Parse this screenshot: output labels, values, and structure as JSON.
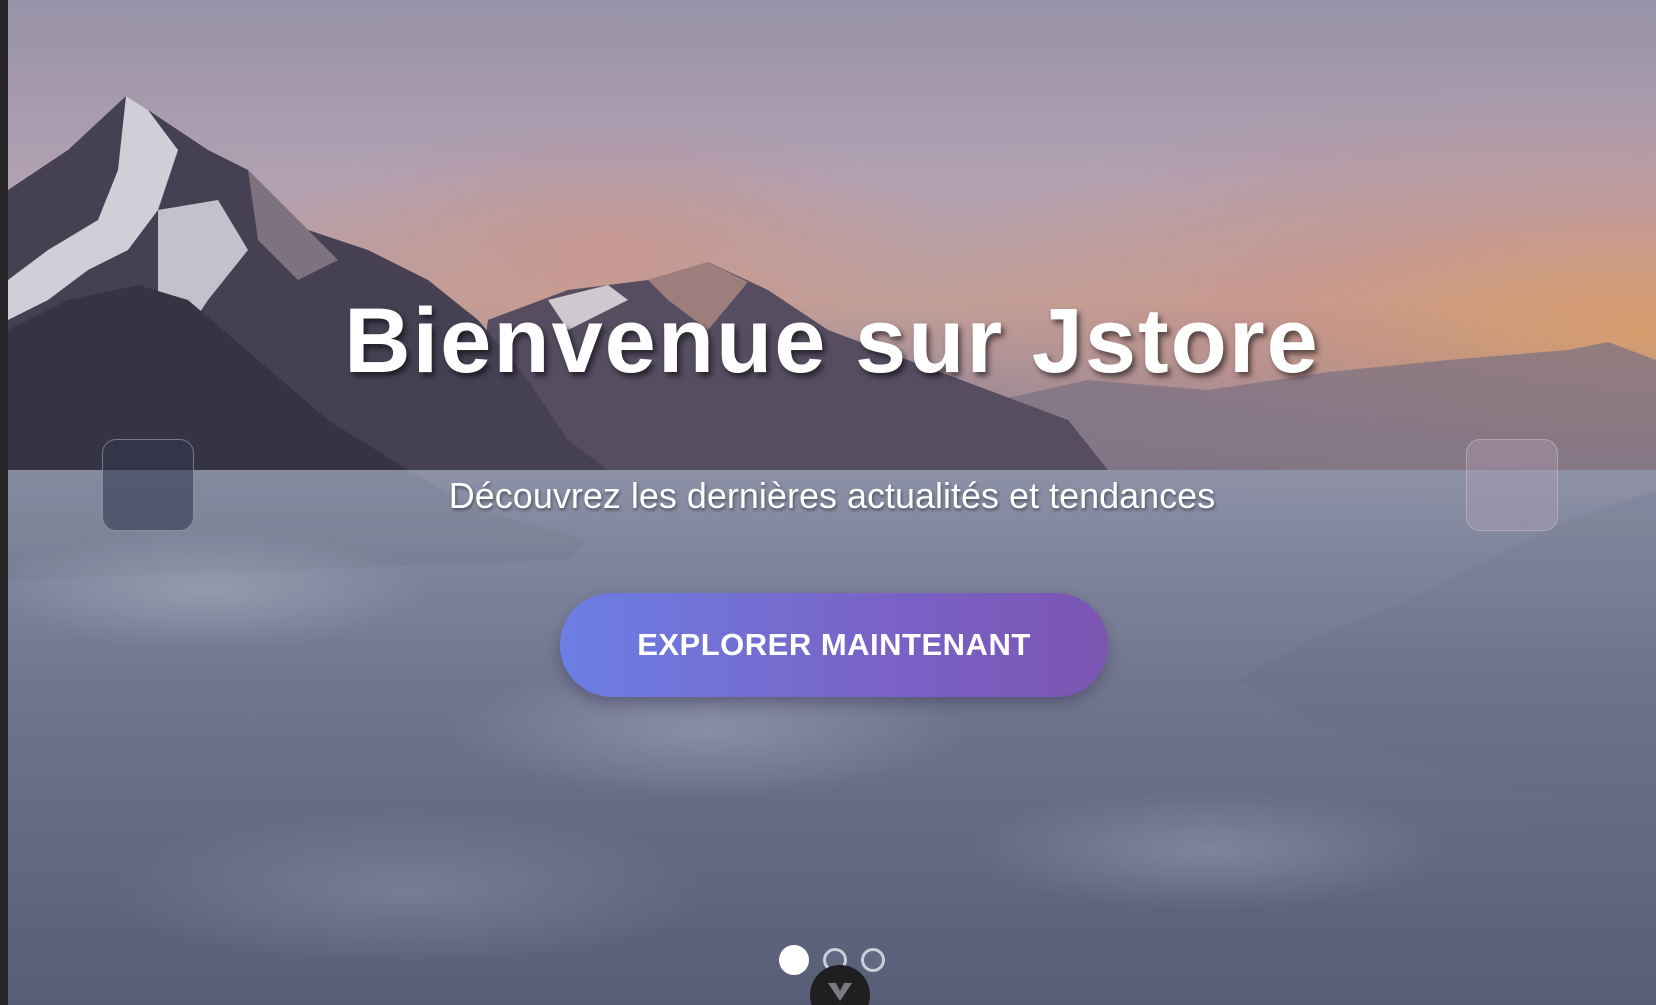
{
  "hero": {
    "title": "Bienvenue sur Jstore",
    "subtitle": "Découvrez les dernières actualités et tendances",
    "cta_label": "EXPLORER MAINTENANT"
  },
  "carousel": {
    "prev_icon": "chevron-left-icon",
    "next_icon": "chevron-right-icon",
    "slide_count": 3,
    "active_index": 0
  },
  "scroll_icon": "chevron-down-icon",
  "colors": {
    "cta_gradient_start": "#6b7fe4",
    "cta_gradient_end": "#7b55b2",
    "text": "#ffffff"
  }
}
